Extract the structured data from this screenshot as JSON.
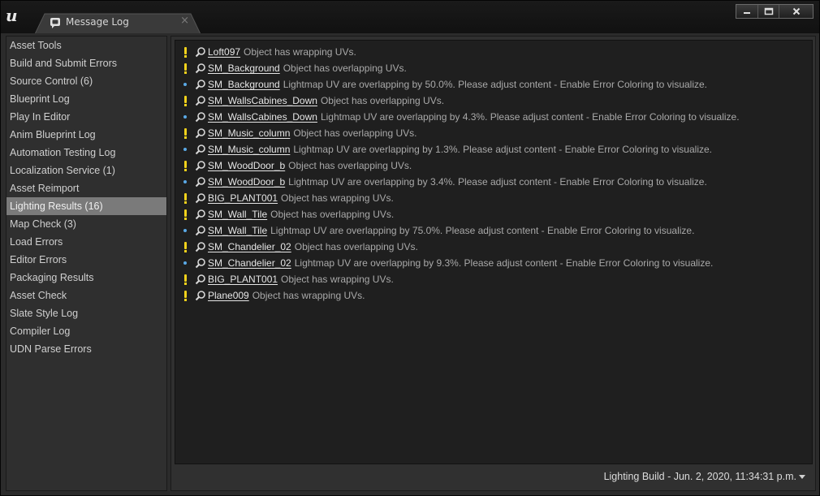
{
  "window": {
    "tab_title": "Message Log"
  },
  "sidebar": {
    "selected_index": 9,
    "items": [
      {
        "label": "Asset Tools"
      },
      {
        "label": "Build and Submit Errors"
      },
      {
        "label": "Source Control (6)"
      },
      {
        "label": "Blueprint Log"
      },
      {
        "label": "Play In Editor"
      },
      {
        "label": "Anim Blueprint Log"
      },
      {
        "label": "Automation Testing Log"
      },
      {
        "label": "Localization Service (1)"
      },
      {
        "label": "Asset Reimport"
      },
      {
        "label": "Lighting Results (16)"
      },
      {
        "label": "Map Check (3)"
      },
      {
        "label": "Load Errors"
      },
      {
        "label": "Editor Errors"
      },
      {
        "label": "Packaging Results"
      },
      {
        "label": "Asset Check"
      },
      {
        "label": "Slate Style Log"
      },
      {
        "label": "Compiler Log"
      },
      {
        "label": "UDN Parse Errors"
      }
    ]
  },
  "log": {
    "messages": [
      {
        "severity": "warning",
        "object": "Loft097",
        "text": "Object has wrapping UVs."
      },
      {
        "severity": "warning",
        "object": "SM_Background",
        "text": "Object has overlapping UVs."
      },
      {
        "severity": "info",
        "object": "SM_Background",
        "text": "Lightmap UV are overlapping by 50.0%. Please adjust content - Enable Error Coloring to visualize."
      },
      {
        "severity": "warning",
        "object": "SM_WallsCabines_Down",
        "text": "Object has overlapping UVs."
      },
      {
        "severity": "info",
        "object": "SM_WallsCabines_Down",
        "text": "Lightmap UV are overlapping by 4.3%. Please adjust content - Enable Error Coloring to visualize."
      },
      {
        "severity": "warning",
        "object": "SM_Music_column",
        "text": "Object has overlapping UVs."
      },
      {
        "severity": "info",
        "object": "SM_Music_column",
        "text": "Lightmap UV are overlapping by 1.3%. Please adjust content - Enable Error Coloring to visualize."
      },
      {
        "severity": "warning",
        "object": "SM_WoodDoor_b",
        "text": "Object has overlapping UVs."
      },
      {
        "severity": "info",
        "object": "SM_WoodDoor_b",
        "text": "Lightmap UV are overlapping by 3.4%. Please adjust content - Enable Error Coloring to visualize."
      },
      {
        "severity": "warning",
        "object": "BIG_PLANT001",
        "text": "Object has wrapping UVs."
      },
      {
        "severity": "warning",
        "object": "SM_Wall_Tile",
        "text": "Object has overlapping UVs."
      },
      {
        "severity": "info",
        "object": "SM_Wall_Tile",
        "text": "Lightmap UV are overlapping by 75.0%. Please adjust content - Enable Error Coloring to visualize."
      },
      {
        "severity": "warning",
        "object": "SM_Chandelier_02",
        "text": "Object has overlapping UVs."
      },
      {
        "severity": "info",
        "object": "SM_Chandelier_02",
        "text": "Lightmap UV are overlapping by 9.3%. Please adjust content - Enable Error Coloring to visualize."
      },
      {
        "severity": "warning",
        "object": "BIG_PLANT001",
        "text": "Object has wrapping UVs."
      },
      {
        "severity": "warning",
        "object": "Plane009",
        "text": "Object has wrapping UVs."
      }
    ]
  },
  "status": {
    "page_label": "Lighting Build - Jun. 2, 2020, 11:34:31 p.m."
  },
  "colors": {
    "warning": "#f2d21b",
    "info": "#5aa9e6",
    "selected": "#7a7a7a"
  }
}
